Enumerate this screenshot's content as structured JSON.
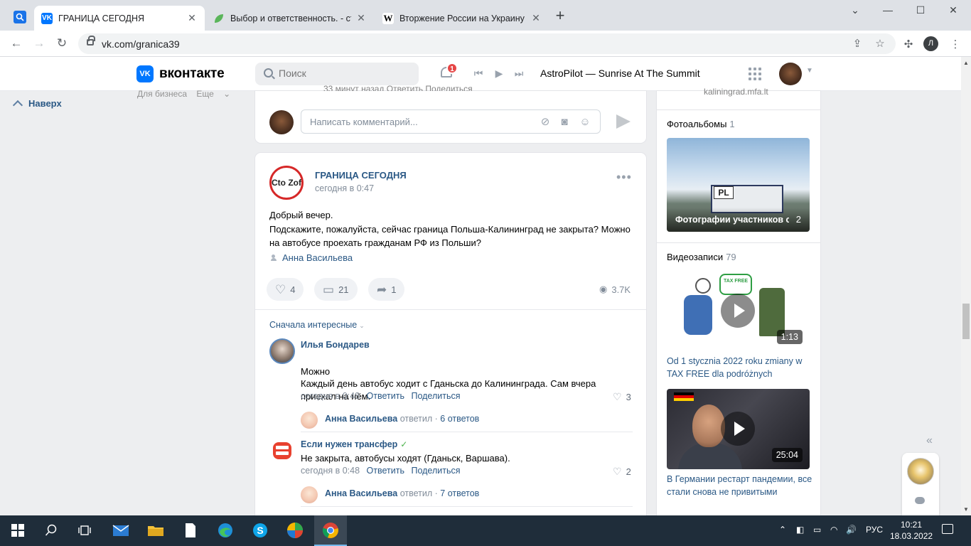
{
  "browser": {
    "tabs": [
      {
        "title": "ГРАНИЦА СЕГОДНЯ",
        "active": true,
        "icon": "vk-icon"
      },
      {
        "title": "Выбор и ответственность. - стр",
        "active": false,
        "icon": "leaf-icon"
      },
      {
        "title": "Вторжение России на Украину (",
        "active": false,
        "icon": "wikipedia-icon"
      }
    ],
    "url": "vk.com/granica39",
    "profile_initial": "Л"
  },
  "vk": {
    "logo_text": "вконтакте",
    "search_placeholder": "Поиск",
    "notification_count": "1",
    "now_playing": "AstroPilot — Sunrise At The Summit",
    "accent": "#0077ff",
    "link_color": "#2a5885"
  },
  "left": {
    "up_label": "Наверх",
    "links": [
      "Для бизнеса",
      "Еще"
    ]
  },
  "comment_box": {
    "cut_text": "33 минут назад  Ответить  Поделиться",
    "placeholder": "Написать комментарий..."
  },
  "post": {
    "author": "ГРАНИЦА СЕГОДНЯ",
    "time": "сегодня в 0:47",
    "avatar_text": "Cto Zof",
    "text_line1": "Добрый вечер.",
    "text_line2": "Подскажите, пожалуйста, сейчас граница Польша-Калининград не закрыта? Можно на автобусе проехать гражданам РФ из Польши?",
    "signed_by": "Анна Васильева",
    "likes": "4",
    "comments": "21",
    "shares": "1",
    "views": "3.7K",
    "sort_label": "Сначала интересные"
  },
  "comments": [
    {
      "name": "Илья Бондарев",
      "text": "Можно\nКаждый день автобус ходит с Гданьска до Калининграда. Сам вчера приехал на нём.",
      "time": "сегодня в 0:48",
      "reply_label": "Ответить",
      "share_label": "Поделиться",
      "likes": "3",
      "thread_author": "Анна Васильева",
      "thread_verb": "ответил",
      "thread_count": "6 ответов"
    },
    {
      "name": "Если нужен трансфер",
      "verified": "✓",
      "text": "Не закрыта, автобусы ходят (Гданьск, Варшава).",
      "time": "сегодня в 0:48",
      "reply_label": "Ответить",
      "share_label": "Поделиться",
      "likes": "2",
      "thread_author": "Анна Васильева",
      "thread_verb": "ответил",
      "thread_count": "7 ответов"
    }
  ],
  "right": {
    "top_link": "kaliningrad.mfa.lt",
    "photos_title": "Фотоальбомы",
    "photos_count": "1",
    "album_title": "Фотографии участников с...",
    "album_count": "2",
    "album_sign": "PL",
    "videos_title": "Видеозаписи",
    "videos_count": "79",
    "videos": [
      {
        "title": "Od 1 stycznia 2022 roku zmiany w TAX FREE dla podróżnych",
        "duration": "1:13",
        "badge": "TAX FREE"
      },
      {
        "title": "В Германии рестарт пандемии, все стали снова не привитыми",
        "duration": "25:04"
      }
    ]
  },
  "taskbar": {
    "lang": "РУС",
    "time": "10:21",
    "date": "18.03.2022"
  }
}
